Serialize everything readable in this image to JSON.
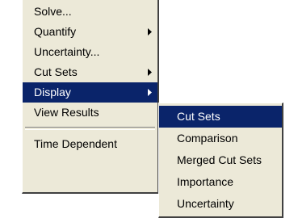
{
  "main_menu": {
    "items": [
      {
        "label": "Solve...",
        "has_submenu": false
      },
      {
        "label": "Quantify",
        "has_submenu": true
      },
      {
        "label": "Uncertainty...",
        "has_submenu": false
      },
      {
        "label": "Cut Sets",
        "has_submenu": true
      },
      {
        "label": "Display",
        "has_submenu": true,
        "highlighted": true
      },
      {
        "label": "View Results",
        "has_submenu": false
      },
      {
        "label": "Time Dependent",
        "has_submenu": false
      }
    ]
  },
  "submenu": {
    "items": [
      {
        "label": "Cut Sets",
        "highlighted": true
      },
      {
        "label": "Comparison"
      },
      {
        "label": "Merged Cut Sets"
      },
      {
        "label": "Importance"
      },
      {
        "label": "Uncertainty"
      }
    ]
  },
  "colors": {
    "menu_background": "#ece9d8",
    "highlight_background": "#0a246a",
    "highlight_text": "#ffffff",
    "text": "#000000"
  }
}
